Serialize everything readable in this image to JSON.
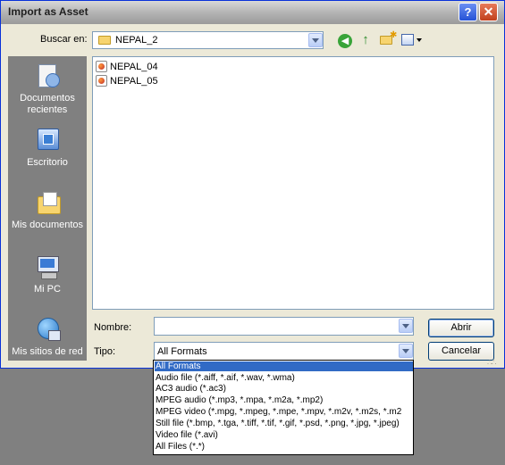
{
  "window": {
    "title": "Import as Asset",
    "help_glyph": "?",
    "close_glyph": "✕"
  },
  "toolbar": {
    "lookin_label": "Buscar en:",
    "lookin_value": "NEPAL_2"
  },
  "places": [
    {
      "label": "Documentos recientes",
      "icon": "recent-documents-icon"
    },
    {
      "label": "Escritorio",
      "icon": "desktop-icon"
    },
    {
      "label": "Mis documentos",
      "icon": "my-documents-icon"
    },
    {
      "label": "Mi PC",
      "icon": "my-computer-icon"
    },
    {
      "label": "Mis sitios de red",
      "icon": "network-places-icon"
    }
  ],
  "files": [
    {
      "name": "NEPAL_04"
    },
    {
      "name": "NEPAL_05"
    }
  ],
  "form": {
    "name_label": "Nombre:",
    "name_value": "",
    "type_label": "Tipo:",
    "type_value": "All Formats",
    "open_label": "Abrir",
    "cancel_label": "Cancelar"
  },
  "type_options": [
    "All Formats",
    "Audio file (*.aiff, *.aif, *.wav, *.wma)",
    "AC3 audio (*.ac3)",
    "MPEG audio (*.mp3, *.mpa, *.m2a, *.mp2)",
    "MPEG video (*.mpg, *.mpeg, *.mpe, *.mpv, *.m2v, *.m2s, *.m2",
    "Still file (*.bmp, *.tga, *.tiff, *.tif, *.gif, *.psd, *.png, *.jpg, *.jpeg)",
    "Video file (*.avi)",
    "All Files (*.*)"
  ],
  "selected_type_index": 0,
  "colors": {
    "dialog_bg": "#ece9d8",
    "selection": "#316ac5",
    "places_bar": "#808080"
  }
}
